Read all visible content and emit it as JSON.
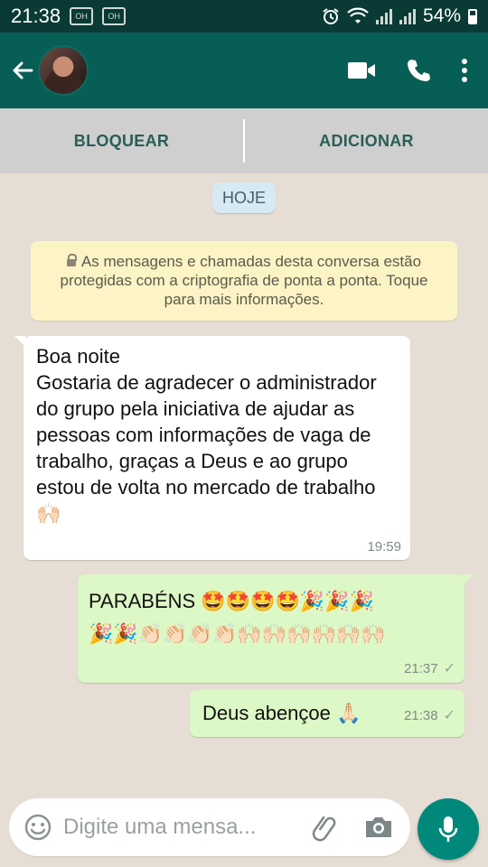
{
  "status_bar": {
    "time": "21:38",
    "mini_icon_1": "OH",
    "mini_icon_2": "OH",
    "battery": "54%",
    "icons": [
      "alarm-icon",
      "wifi-icon",
      "signal-icon",
      "signal-icon",
      "battery-icon"
    ]
  },
  "header": {
    "icons": [
      "back-arrow-icon",
      "video-call-icon",
      "phone-call-icon",
      "more-vertical-icon"
    ]
  },
  "actions": {
    "block_label": "BLOQUEAR",
    "add_label": "ADICIONAR"
  },
  "chat": {
    "date_chip": "HOJE",
    "encryption_notice": "As mensagens e chamadas desta conversa estão protegidas com a criptografia de ponta a ponta. Toque para mais informações.",
    "messages": [
      {
        "direction": "in",
        "text": "Boa noite\nGostaria de agradecer o administrador do grupo pela iniciativa de ajudar as pessoas com informações de vaga de trabalho, graças a Deus e ao grupo estou de volta no mercado de trabalho 🙌🏻",
        "time": "19:59"
      },
      {
        "direction": "out",
        "text": "PARABÉNS 🤩🤩🤩🤩🎉🎉🎉\n🎉🎉👏🏻👏🏻👏🏻👏🏻🙌🏻🙌🏻🙌🏻🙌🏻🙌🏻🙌🏻",
        "time": "21:37",
        "status": "✓"
      },
      {
        "direction": "out",
        "text": "Deus abençoe 🙏🏻",
        "time": "21:38",
        "status": "✓"
      }
    ]
  },
  "composer": {
    "placeholder": "Digite uma mensa...",
    "icons": [
      "emoji-icon",
      "attach-icon",
      "camera-icon",
      "microphone-icon"
    ]
  },
  "colors": {
    "header": "#075e54",
    "status_bar": "#0a3a35",
    "outgoing_bubble": "#dcf8c6",
    "incoming_bubble": "#ffffff",
    "mic_button": "#00897b",
    "notice": "#fdf4c5",
    "date_chip": "#d7eaf4"
  }
}
